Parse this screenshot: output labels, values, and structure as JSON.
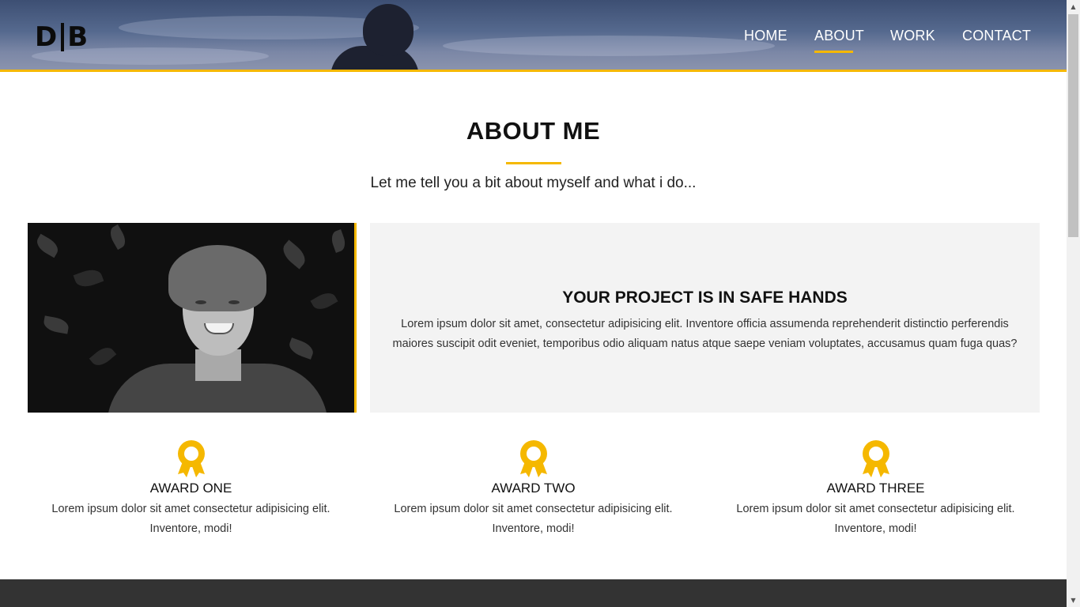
{
  "header": {
    "logo_left": "D",
    "logo_right": "B",
    "nav": [
      {
        "label": "HOME",
        "active": false
      },
      {
        "label": "ABOUT",
        "active": true
      },
      {
        "label": "WORK",
        "active": false
      },
      {
        "label": "CONTACT",
        "active": false
      }
    ]
  },
  "about": {
    "title": "ABOUT ME",
    "subtitle": "Let me tell you a bit about myself and what i do..."
  },
  "panel": {
    "title": "YOUR PROJECT IS IN SAFE HANDS",
    "text": "Lorem ipsum dolor sit amet, consectetur adipisicing elit. Inventore officia assumenda reprehenderit distinctio perferendis maiores suscipit odit eveniet, temporibus odio aliquam natus atque saepe veniam voluptates, accusamus quam fuga quas?"
  },
  "awards": [
    {
      "title": "AWARD ONE",
      "text": "Lorem ipsum dolor sit amet consectetur adipisicing elit. Inventore, modi!",
      "icon": "award-ribbon-icon"
    },
    {
      "title": "AWARD TWO",
      "text": "Lorem ipsum dolor sit amet consectetur adipisicing elit. Inventore, modi!",
      "icon": "award-ribbon-icon"
    },
    {
      "title": "AWARD THREE",
      "text": "Lorem ipsum dolor sit amet consectetur adipisicing elit. Inventore, modi!",
      "icon": "award-ribbon-icon"
    }
  ],
  "colors": {
    "accent": "#f5b800",
    "panel_bg": "#f3f3f3",
    "footer_bg": "#333333"
  }
}
